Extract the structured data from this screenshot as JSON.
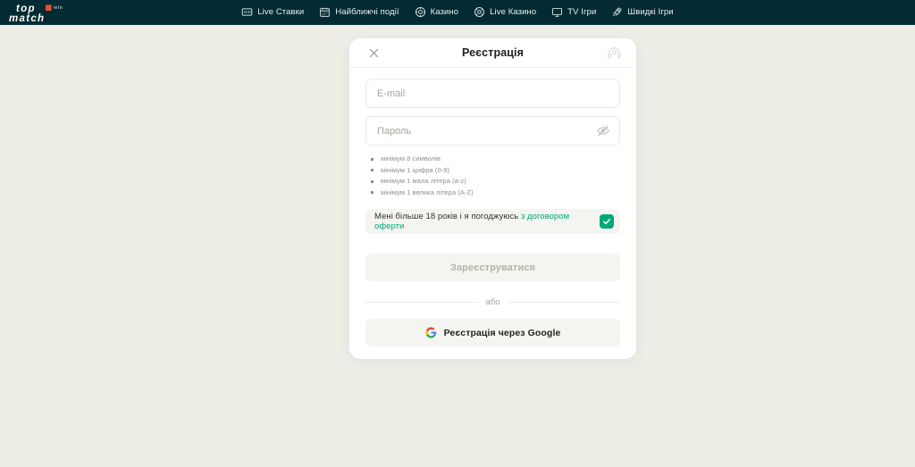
{
  "brand": {
    "logo_top": "top",
    "logo_bottom": "match",
    "logo_badge": "win",
    "accent_color": "#e8502a"
  },
  "nav": {
    "background_color": "#042b34",
    "items": [
      {
        "label": "Live Ставки",
        "icon": "live-bet-icon"
      },
      {
        "label": "Найближчі події",
        "icon": "calendar-icon"
      },
      {
        "label": "Казино",
        "icon": "casino-chip-icon"
      },
      {
        "label": "Live Казино",
        "icon": "live-casino-icon"
      },
      {
        "label": "TV Ігри",
        "icon": "tv-icon"
      },
      {
        "label": "Швидкі Ігри",
        "icon": "rocket-icon"
      }
    ]
  },
  "modal": {
    "title": "Реєстрація",
    "close_icon": "close-icon",
    "support_icon": "support-headset-icon",
    "fields": {
      "email": {
        "placeholder": "E-mail",
        "value": ""
      },
      "password": {
        "placeholder": "Пароль",
        "value": "",
        "toggle_icon": "eye-off-icon"
      }
    },
    "password_requirements": [
      "мінімум 8 символів",
      "мінімум 1 цифра (0-9)",
      "мінімум 1 мала літера (a-z)",
      "мінімум 1 велика літера (A-Z)"
    ],
    "agreement": {
      "text_before": "Мені більше 18 років і я погоджуюсь ",
      "link_text": "з договором оферти",
      "checked": true,
      "checkbox_color": "#00a877",
      "link_color": "#00a877"
    },
    "submit_button": {
      "label": "Зареєструватися",
      "disabled": true
    },
    "divider_label": "або",
    "google_button": {
      "label": "Реєстрація через Google",
      "icon": "google-g-icon"
    }
  },
  "page": {
    "background_color": "#eeeee7"
  }
}
